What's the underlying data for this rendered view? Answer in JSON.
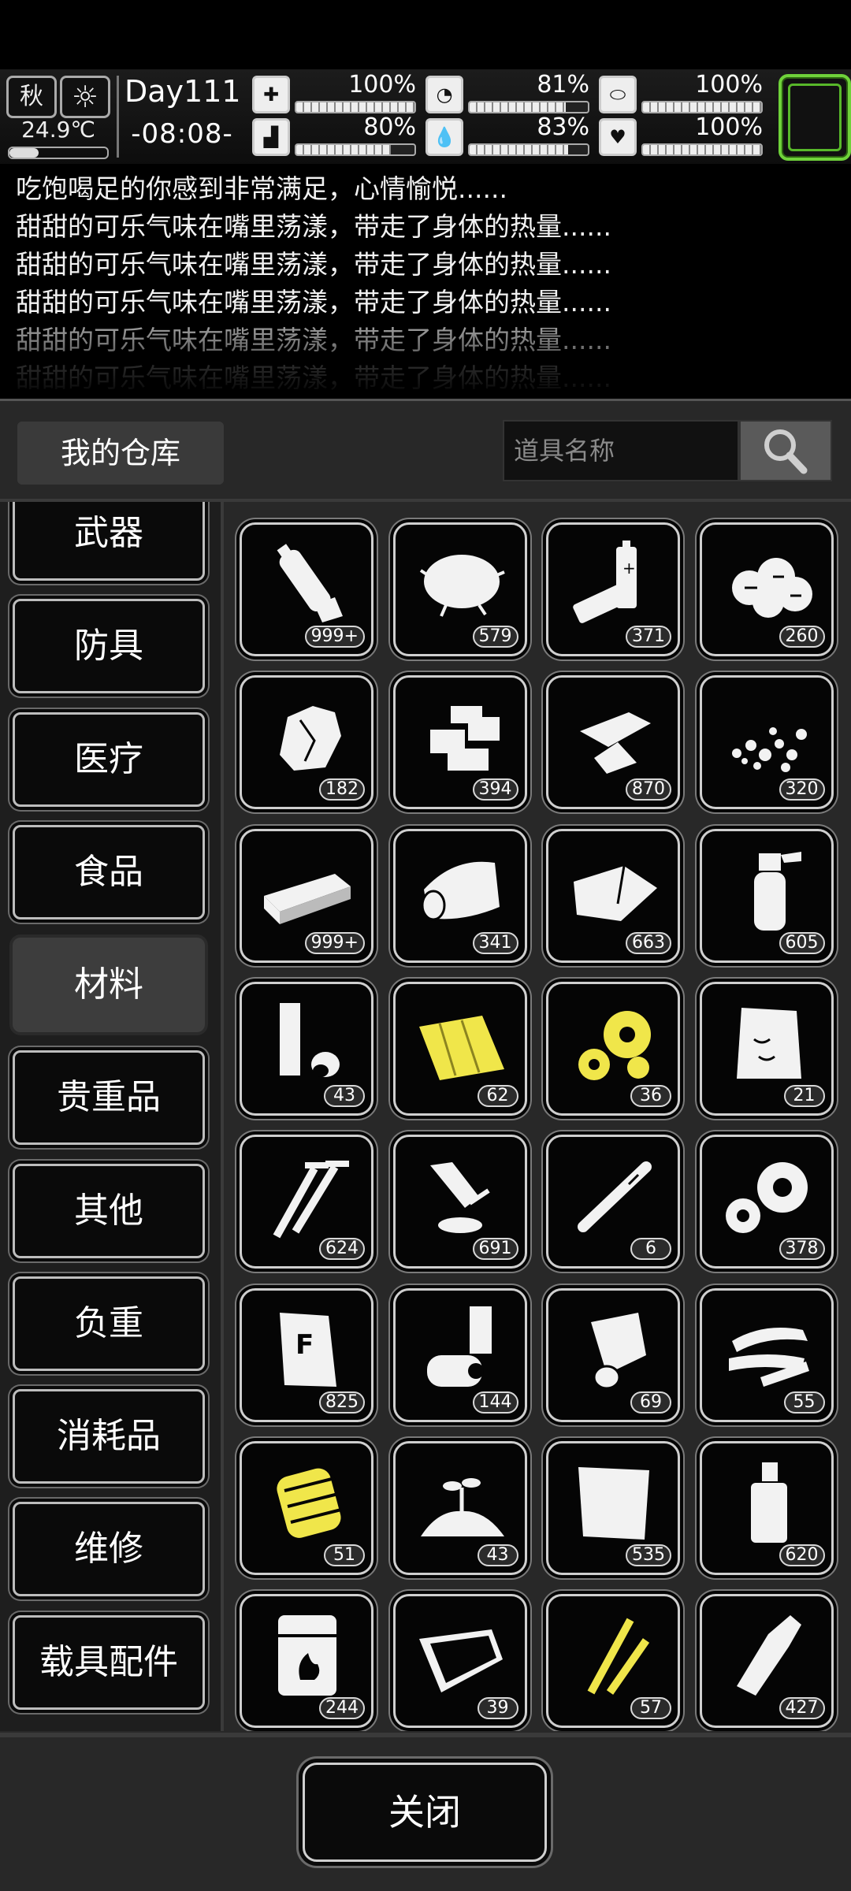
{
  "status_bar": {
    "season": "秋",
    "weather_icon": "sun-icon",
    "temperature": "24.9℃",
    "temperature_level": 0.3,
    "day": "Day111",
    "time": "-08:08-",
    "stats": [
      {
        "icon": "medkit-icon",
        "value": "100%",
        "level": 1.0
      },
      {
        "icon": "stomach-icon",
        "value": "81%",
        "level": 0.81
      },
      {
        "icon": "pill-icon",
        "value": "100%",
        "level": 1.0
      },
      {
        "icon": "boot-icon",
        "value": "80%",
        "level": 0.8
      },
      {
        "icon": "water-drop-icon",
        "value": "83%",
        "level": 0.83
      },
      {
        "icon": "heart-icon",
        "value": "100%",
        "level": 1.0
      }
    ],
    "accent_color": "#6fd23a"
  },
  "log": {
    "lines": [
      "吃饱喝足的你感到非常满足，心情愉悦......",
      "甜甜的可乐气味在嘴里荡漾，带走了身体的热量......",
      "甜甜的可乐气味在嘴里荡漾，带走了身体的热量......",
      "甜甜的可乐气味在嘴里荡漾，带走了身体的热量......",
      "甜甜的可乐气味在嘴里荡漾，带走了身体的热量......",
      "甜甜的可乐气味在嘴里荡漾，带走了身体的热量......"
    ]
  },
  "panel": {
    "title": "我的仓库",
    "search_placeholder": "道具名称",
    "search_icon": "magnifier-icon"
  },
  "categories": [
    {
      "label": "武器",
      "selected": false
    },
    {
      "label": "防具",
      "selected": false
    },
    {
      "label": "医疗",
      "selected": false
    },
    {
      "label": "食品",
      "selected": false
    },
    {
      "label": "材料",
      "selected": true
    },
    {
      "label": "贵重品",
      "selected": false
    },
    {
      "label": "其他",
      "selected": false
    },
    {
      "label": "负重",
      "selected": false
    },
    {
      "label": "消耗品",
      "selected": false
    },
    {
      "label": "维修",
      "selected": false
    },
    {
      "label": "载具配件",
      "selected": false
    }
  ],
  "items": [
    {
      "icon": "plastic-bottle-icon",
      "count": "999+"
    },
    {
      "icon": "fiber-bundle-icon",
      "count": "579"
    },
    {
      "icon": "battery-icon",
      "count": "371"
    },
    {
      "icon": "cotton-icon",
      "count": "260"
    },
    {
      "icon": "rock-icon",
      "count": "182"
    },
    {
      "icon": "bricks-icon",
      "count": "394"
    },
    {
      "icon": "glass-shard-icon",
      "count": "870"
    },
    {
      "icon": "gravel-icon",
      "count": "320"
    },
    {
      "icon": "wood-plank-icon",
      "count": "999+"
    },
    {
      "icon": "cloth-roll-icon",
      "count": "341"
    },
    {
      "icon": "fabric-icon",
      "count": "663"
    },
    {
      "icon": "spray-bottle-icon",
      "count": "605"
    },
    {
      "icon": "pipe-icon",
      "count": "43"
    },
    {
      "icon": "tarp-icon",
      "count": "62",
      "rare": true
    },
    {
      "icon": "gears-icon",
      "count": "36",
      "rare": true
    },
    {
      "icon": "sack-icon",
      "count": "21"
    },
    {
      "icon": "screws-icon",
      "count": "624"
    },
    {
      "icon": "glue-tube-icon",
      "count": "691"
    },
    {
      "icon": "rod-icon",
      "count": "6"
    },
    {
      "icon": "cogwheels-icon",
      "count": "378"
    },
    {
      "icon": "cement-bag-icon",
      "count": "825"
    },
    {
      "icon": "tape-rolls-icon",
      "count": "144"
    },
    {
      "icon": "paper-roll-icon",
      "count": "69"
    },
    {
      "icon": "strip-icon",
      "count": "55"
    },
    {
      "icon": "spring-part-icon",
      "count": "51",
      "rare": true
    },
    {
      "icon": "soil-sprout-icon",
      "count": "43"
    },
    {
      "icon": "paper-sheet-icon",
      "count": "535"
    },
    {
      "icon": "oil-bottle-icon",
      "count": "620"
    },
    {
      "icon": "fuel-barrel-icon",
      "count": "244"
    },
    {
      "icon": "film-icon",
      "count": "39"
    },
    {
      "icon": "wire-icon",
      "count": "57",
      "rare": true
    },
    {
      "icon": "glass-bottle-icon",
      "count": "427"
    }
  ],
  "rare_color": "#f0e64a",
  "footer": {
    "close_label": "关闭"
  }
}
